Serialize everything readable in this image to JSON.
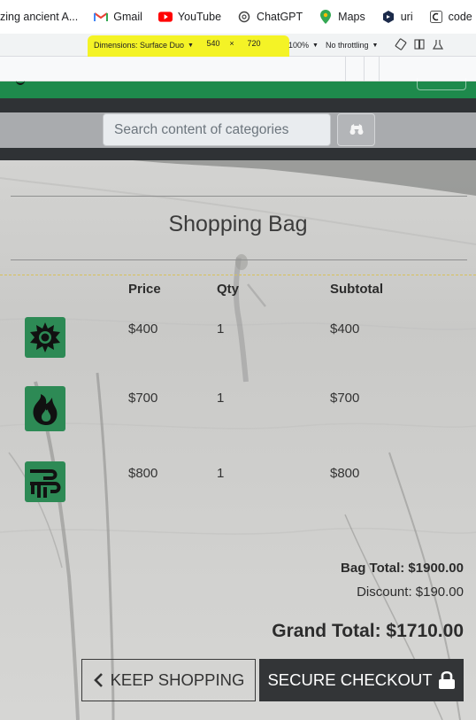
{
  "bookmarks": [
    {
      "label": "zing ancient A...",
      "icon": "truncated-bookmark"
    },
    {
      "label": "Gmail",
      "icon": "gmail-icon"
    },
    {
      "label": "YouTube",
      "icon": "youtube-icon"
    },
    {
      "label": "ChatGPT",
      "icon": "chatgpt-icon"
    },
    {
      "label": "Maps",
      "icon": "maps-icon"
    },
    {
      "label": "uri",
      "icon": "uri-icon"
    },
    {
      "label": "code institu",
      "icon": "code-institute-icon"
    }
  ],
  "devtools": {
    "device": "Dimensions: Surface Duo",
    "width": "540",
    "height": "720",
    "separator": "×",
    "zoom": "100%",
    "throttling": "No throttling",
    "highlight_color": "#f4f310"
  },
  "search": {
    "placeholder": "Search content of categories",
    "button_icon": "binoculars-icon"
  },
  "bag": {
    "title": "Shopping Bag",
    "headers": {
      "price": "Price",
      "qty": "Qty",
      "subtotal": "Subtotal"
    },
    "items": [
      {
        "icon": "sun-icon",
        "price": "$400",
        "qty": "1",
        "subtotal": "$400"
      },
      {
        "icon": "fire-icon",
        "price": "$700",
        "qty": "1",
        "subtotal": "$700"
      },
      {
        "icon": "wind-icon",
        "price": "$800",
        "qty": "1",
        "subtotal": "$800"
      }
    ],
    "bag_total": "Bag Total: $1900.00",
    "discount": "Discount: $190.00",
    "grand_total": "Grand Total: $1710.00",
    "keep_shopping": "KEEP SHOPPING",
    "secure_checkout": "SECURE CHECKOUT"
  },
  "colors": {
    "brand_green": "#1e8a4c",
    "product_tile": "#2d8a55",
    "dark": "#2f3235"
  }
}
